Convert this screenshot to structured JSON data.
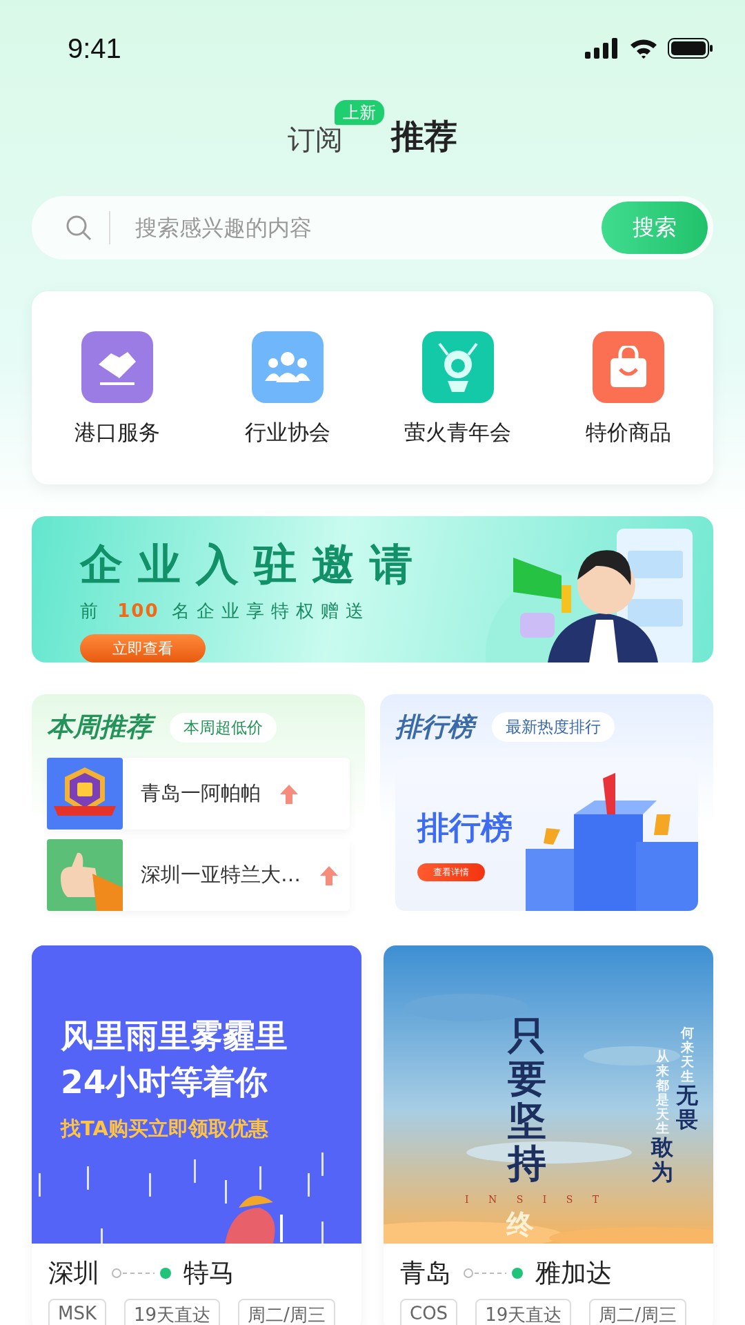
{
  "status_bar": {
    "time": "9:41"
  },
  "tabs": [
    {
      "label": "订阅",
      "selected": false,
      "badge": "上新"
    },
    {
      "label": "推荐",
      "selected": true
    }
  ],
  "search": {
    "placeholder": "搜索感兴趣的内容",
    "button": "搜索"
  },
  "shortcuts": [
    {
      "label": "港口服务",
      "kind": "handshake",
      "color": "#9a7ce4"
    },
    {
      "label": "行业协会",
      "kind": "people",
      "color": "#6fb6fb"
    },
    {
      "label": "萤火青年会",
      "kind": "robot",
      "color": "#14c9a8"
    },
    {
      "label": "特价商品",
      "kind": "bag",
      "color": "#fb7053"
    }
  ],
  "banner": {
    "title": "企业入驻邀请",
    "subtitle": "前 **100** 名企业享特权赠送",
    "button": "立即查看"
  },
  "weekly": {
    "title": "本周推荐",
    "tag": "本周超低价",
    "items": [
      {
        "name": "青岛一阿帕帕",
        "kind": "badge"
      },
      {
        "name": "深圳一亚特兰大…",
        "kind": "thumb"
      }
    ]
  },
  "ranking": {
    "title": "排行榜",
    "tag": "最新热度排行",
    "image_title": "排行榜",
    "image_button": "查看详情"
  },
  "routes": [
    {
      "poster": {
        "kind": "rain",
        "lines": [
          "风里雨里雾霾里",
          "24小时等着你"
        ],
        "highlight": "找TA购买立即领取优惠"
      },
      "from": "深圳",
      "to": "特马",
      "tags": [
        "MSK",
        "19天直达",
        "周二/周三"
      ]
    },
    {
      "poster": {
        "kind": "sky",
        "main": "只要坚持",
        "cut": "终",
        "word": "I N S I S T",
        "columns": [
          {
            "small": "何来天生",
            "big": "无畏"
          },
          {
            "small": "从来都是天生",
            "big": "敢为"
          }
        ]
      },
      "from": "青岛",
      "to": "雅加达",
      "tags": [
        "COS",
        "19天直达",
        "周二/周三"
      ]
    }
  ]
}
